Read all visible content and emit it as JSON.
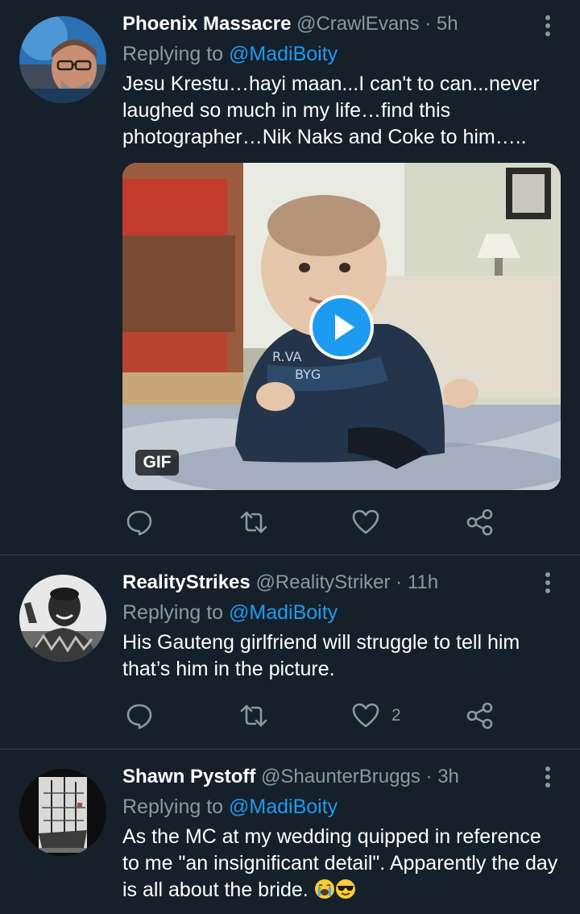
{
  "colors": {
    "background": "#15202b",
    "muted": "#8899a6",
    "link": "#1d9bf0",
    "divider": "#38444d"
  },
  "tweets": [
    {
      "name": "Phoenix Massacre",
      "handle": "@CrawlEvans",
      "separator": "·",
      "time": "5h",
      "replying_prefix": "Replying to ",
      "replying_to": "@MadiBoity",
      "text": "Jesu Krestu…hayi maan...I can't to can...never laughed so much in my life…find this photographer…Nik Naks and Coke to him…..",
      "media": {
        "badge": "GIF",
        "play_icon": "play-icon"
      },
      "actions": {
        "reply": "",
        "retweet": "",
        "like": "",
        "share": ""
      }
    },
    {
      "name": "RealityStrikes",
      "handle": "@RealityStriker",
      "separator": "·",
      "time": "11h",
      "replying_prefix": "Replying to ",
      "replying_to": "@MadiBoity",
      "text": "His Gauteng girlfriend will struggle to tell him that’s him in the picture.",
      "actions": {
        "reply": "",
        "retweet": "",
        "like": "2",
        "share": ""
      }
    },
    {
      "name": "Shawn Pystoff",
      "handle": "@ShaunterBruggs",
      "separator": "·",
      "time": "3h",
      "replying_prefix": "Replying to ",
      "replying_to": "@MadiBoity",
      "text": "As the MC at my wedding quipped in reference to me \"an insignificant detail\". Apparently the day is all about the bride. ",
      "emojis": [
        "loudly-crying-face-emoji",
        "smiling-face-with-sunglasses-emoji"
      ]
    }
  ],
  "icons": {
    "reply": "reply-icon",
    "retweet": "retweet-icon",
    "like": "heart-icon",
    "share": "share-icon",
    "more": "more-vertical-icon"
  }
}
